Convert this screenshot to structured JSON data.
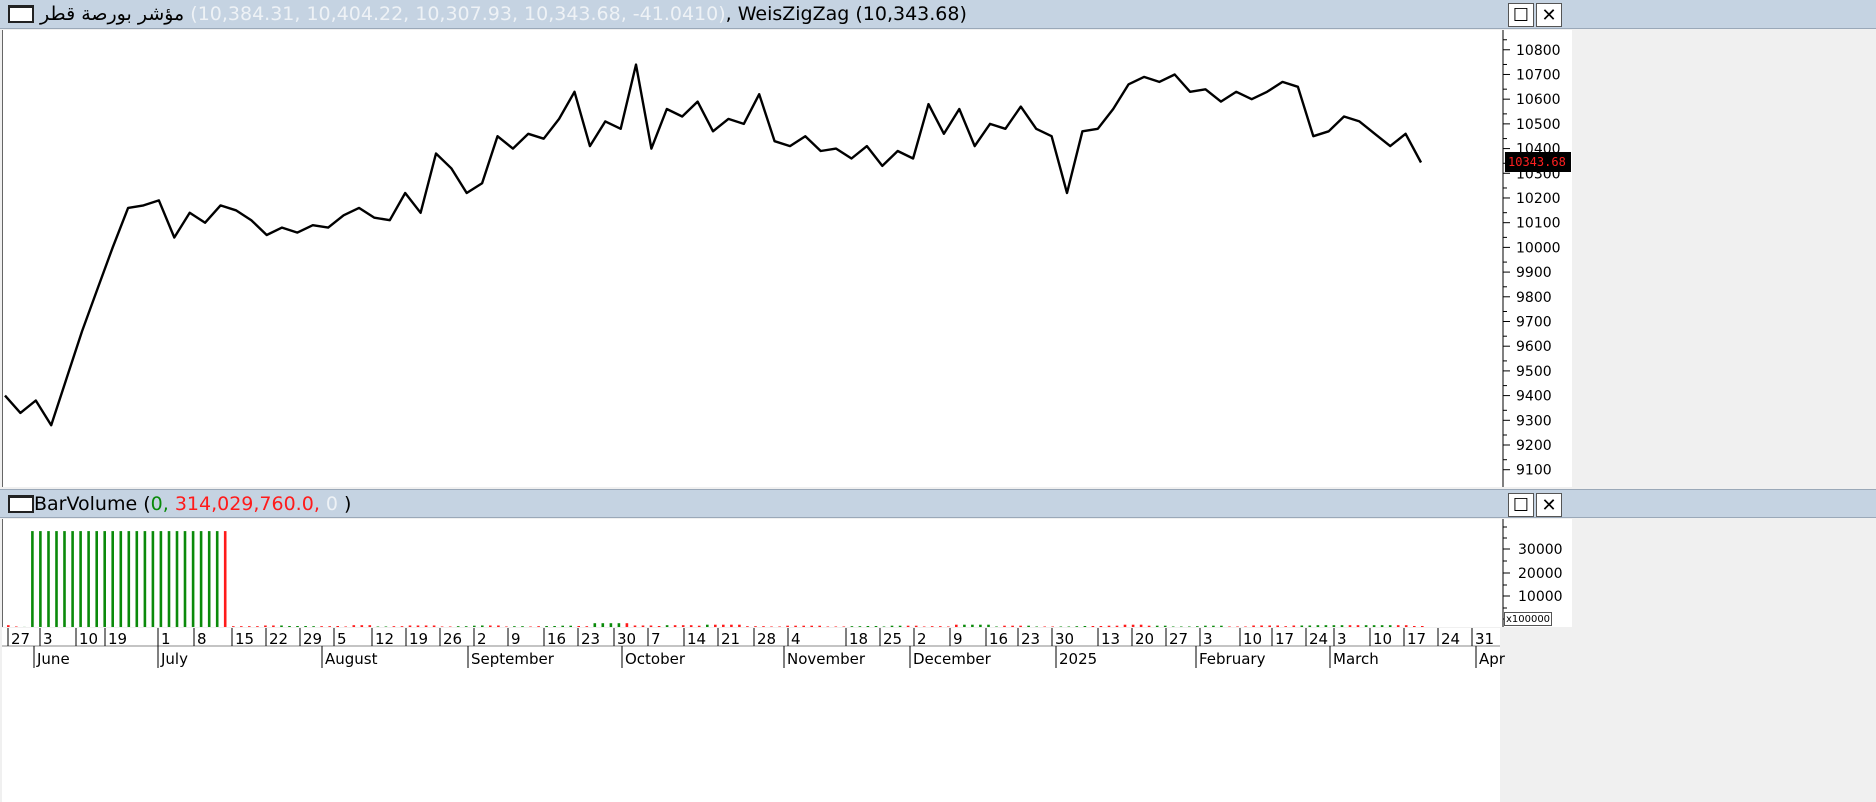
{
  "price_panel": {
    "title": "مؤشر بورصة قطر",
    "ohlc_text": "(10,384.31, 10,404.22, 10,307.93, 10,343.68, -41.0410)",
    "indicator_text": ", WeisZigZag (10,343.68)",
    "last_value_label": "10343.68",
    "restore_icon": "☐",
    "close_icon": "✕"
  },
  "volume_panel": {
    "title": "BarVolume",
    "open_paren": "(",
    "value_green": "0,",
    "value_red": "314,029,760.0,",
    "value_faded": "0",
    "close_paren": ")",
    "multiplier_label": "x100000",
    "restore_icon": "☐",
    "close_icon": "✕"
  },
  "colors": {
    "up": "#0a8a0a",
    "down": "#ff1a1a",
    "line": "#000000",
    "last_value_bg": "#000000",
    "last_value_text": "#ff2020",
    "header_bg": "#c5d3e2"
  },
  "chart_data": [
    {
      "type": "line",
      "series": [
        {
          "values": [
            9400,
            9330,
            9380,
            9280,
            9470,
            9660,
            9830,
            10000,
            10160,
            10170,
            10190,
            10040,
            10140,
            10100,
            10170,
            10150,
            10110,
            10050,
            10080,
            10060,
            10090,
            10080,
            10130,
            10160,
            10120,
            10110,
            10220,
            10140,
            10380,
            10320,
            10220,
            10260,
            10450,
            10400,
            10460,
            10440,
            10520,
            10630,
            10410,
            10510,
            10480,
            10740,
            10400,
            10560,
            10530,
            10590,
            10470,
            10520,
            10500,
            10620,
            10430,
            10410,
            10450,
            10390,
            10400,
            10360,
            10410,
            10330,
            10390,
            10360,
            10580,
            10460,
            10560,
            10410,
            10500,
            10480,
            10570,
            10480,
            10450,
            10220,
            10470,
            10480,
            10560,
            10660,
            10690,
            10670,
            10700,
            10630,
            10640,
            10590,
            10630,
            10600,
            10630,
            10670,
            10650,
            10450,
            10470,
            10530,
            10510,
            10460,
            10410,
            10460,
            10343.68
          ]
        }
      ],
      "ylim": [
        9030,
        10880
      ],
      "yticks": [
        9100,
        9200,
        9300,
        9400,
        9500,
        9600,
        9700,
        9800,
        9900,
        10000,
        10100,
        10200,
        10300,
        10400,
        10500,
        10600,
        10700,
        10800
      ]
    },
    {
      "type": "bar",
      "series": [
        {
          "name": "BarVolume",
          "values": [
            0,
            0,
            0,
            0,
            314000,
            314000,
            314000,
            314000,
            314000,
            314000,
            314000,
            314000,
            314000,
            314000,
            314000,
            314000,
            314000,
            314000,
            314000,
            314000,
            314000,
            314000,
            314000,
            314000,
            314000,
            314000,
            314000,
            314000,
            0,
            0,
            0,
            0,
            0,
            0,
            0,
            0,
            0,
            0,
            0,
            0,
            0,
            0,
            0,
            0,
            0,
            0,
            0,
            0,
            0,
            0,
            0,
            0,
            0,
            0,
            0,
            0,
            0,
            0,
            0,
            0,
            0,
            0,
            0,
            0,
            0,
            0,
            0,
            0,
            0,
            0,
            0,
            0,
            0,
            0,
            0,
            0,
            0,
            0,
            0,
            0,
            0,
            0,
            0,
            0,
            0,
            0,
            0,
            0,
            0,
            0,
            0,
            0,
            0,
            0,
            0,
            0,
            0,
            0,
            0,
            0,
            0,
            0,
            0,
            0,
            0,
            0,
            0,
            0,
            0,
            0,
            0,
            0,
            0,
            0,
            0,
            0,
            0,
            0,
            0,
            0,
            0,
            0,
            0,
            0,
            0,
            0,
            0,
            0,
            0,
            0,
            0,
            0,
            0,
            0,
            0,
            0,
            0,
            0,
            0,
            0,
            0,
            0,
            0,
            0,
            0,
            0,
            0,
            0,
            0,
            0,
            0,
            0,
            0,
            0,
            0,
            0,
            0,
            0,
            0,
            0,
            0,
            0,
            0,
            0,
            0,
            0,
            0,
            0,
            0,
            0,
            0,
            0,
            0,
            0,
            0,
            0,
            0,
            0,
            0,
            0,
            0,
            0,
            0,
            0,
            0,
            0,
            0,
            0,
            0,
            0,
            0,
            0,
            0,
            0,
            0,
            0,
            0,
            0,
            0,
            0,
            0,
            0,
            0,
            0,
            0,
            0,
            0,
            0,
            0,
            0,
            0,
            0,
            0,
            0,
            0,
            0,
            0,
            0,
            0,
            0,
            0,
            0,
            0,
            0,
            0,
            0,
            0,
            0,
            0,
            0,
            0,
            0,
            0,
            0,
            0,
            0,
            0,
            0
          ]
        }
      ],
      "ylim": [
        0,
        37000
      ],
      "yticks": [
        10000,
        20000,
        30000
      ],
      "ytick_labels": [
        "10000",
        "20000",
        "30000"
      ],
      "y_unit": "x100000"
    }
  ],
  "volume_values": [
    0.7,
    0.2,
    0,
    38,
    38,
    38,
    38,
    38,
    38,
    38,
    38,
    38,
    38,
    38,
    38,
    38,
    38,
    38,
    38,
    38,
    38,
    38,
    38,
    38,
    38,
    38,
    38,
    38,
    0.3,
    0.3,
    0.3,
    0.3,
    0.6,
    0.6,
    0.6,
    0.4,
    0.4,
    0.4,
    0.3,
    0.3,
    0.3,
    0.4,
    0.2,
    0.7,
    0.7,
    0.7,
    0.2,
    0.2,
    0.3,
    0.3,
    0.6,
    0.6,
    0.6,
    0.6,
    0.2,
    0.2,
    0.3,
    0.3,
    0.5,
    0.6,
    0.6,
    0.6,
    0.2,
    0.3,
    0.3,
    0.2,
    0.3,
    0.4,
    0.4,
    0.5,
    0.5,
    0.4,
    0.3,
    1.5,
    1.5,
    1.5,
    1.5,
    1.5,
    0.6,
    0.6,
    0.6,
    0.4,
    0.7,
    0.7,
    0.7,
    0.7,
    0.5,
    0.9,
    0.9,
    0.9,
    0.9,
    0.9,
    0.3,
    0.3,
    0.3,
    0.2,
    0.2,
    0.5,
    0.5,
    0.5,
    0.5,
    0.5,
    0.2,
    0.2,
    0.2,
    0.3,
    0.3,
    0.4,
    0.4,
    0.2,
    0.5,
    0.5,
    0.5,
    0.5,
    0.2,
    0.3,
    0.3,
    0.2,
    0.9,
    0.9,
    0.9,
    0.9,
    0.9,
    0.2,
    0.5,
    0.5,
    0.5,
    0.5,
    0.2,
    0.2,
    0.2,
    0.2,
    0.2,
    0.3,
    0.4,
    0.4,
    0.4,
    0.5,
    0.5,
    0.9,
    0.9,
    0.9,
    0.5,
    0.5,
    0.5,
    0.2,
    0.2,
    0.2,
    0.3,
    0.5,
    0.5,
    0.5,
    0.2,
    0.2,
    0.2,
    0.6,
    0.6,
    0.6,
    0.6,
    0.3,
    0.6,
    0.6,
    0.6,
    0.7,
    0.7,
    0.7,
    0.7,
    0.7,
    0.7,
    0.7,
    0.7,
    0.7,
    0.7,
    0.7,
    0.7,
    0.4,
    0.4
  ],
  "volume_colors": "rrgggggggggggggggggggggggggrrrrrrrgggggrrrrrrrggrrrrrrrrggggrrrggrrggggrrggggrrrrrgrrrrgrrrrrrrrrrrrrrrrrgggggggrrrrrrrgggggrrrggrrggggrrrrrrrrgggggggggrrrrrrrrrggggggrrggggrrrrrrrrrggggggggrrrrrrrrrrrrrr",
  "x_axis": {
    "day_ticks": [
      "27",
      "3",
      "10",
      "19",
      "1",
      "8",
      "15",
      "22",
      "29",
      "5",
      "12",
      "19",
      "26",
      "2",
      "9",
      "16",
      "23",
      "30",
      "7",
      "14",
      "21",
      "28",
      "4",
      "18",
      "25",
      "2",
      "9",
      "16",
      "23",
      "30",
      "13",
      "20",
      "27",
      "3",
      "10",
      "17",
      "24",
      "3",
      "10",
      "17",
      "24",
      "31"
    ],
    "month_labels": [
      "June",
      "July",
      "August",
      "September",
      "October",
      "November",
      "December",
      "2025",
      "February",
      "March",
      "Apr"
    ]
  }
}
